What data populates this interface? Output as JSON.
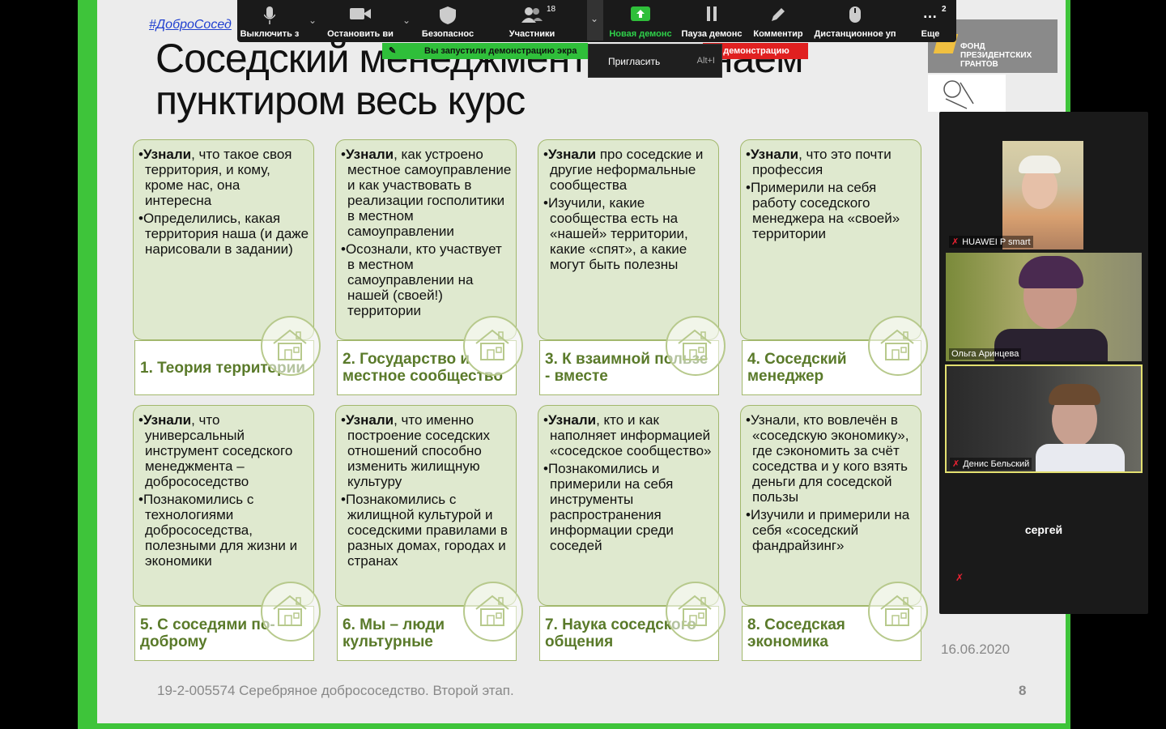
{
  "slide": {
    "hashtag": "#ДоброСосед",
    "title_line1": "Соседский менеджмент –",
    "title_line1_end": "чинаем",
    "title_line2": "пунктиром весь курс",
    "date": "16.06.2020",
    "footer": "19-2-005574 Серебряное добрососедство. Второй этап.",
    "page_number": "8",
    "logo_text": "ФОНД ПРЕЗИДЕНТСКИХ ГРАНТОВ",
    "cards": [
      {
        "bullets": [
          {
            "bold": "Узнали",
            "rest": ", что такое своя территория, и кому, кроме нас, она интересна"
          },
          {
            "bold": "",
            "rest": "Определились, какая территория наша (и даже нарисовали в задании)"
          }
        ],
        "label": "1. Теория территории"
      },
      {
        "bullets": [
          {
            "bold": "Узнали",
            "rest": ", как устроено местное самоуправление и как участвовать в реализации госполитики в местном самоуправлении"
          },
          {
            "bold": "",
            "rest": "Осознали, кто участвует в местном самоуправлении на нашей (своей!) территории"
          }
        ],
        "label": "2. Государство и местное сообщество"
      },
      {
        "bullets": [
          {
            "bold": "Узнали",
            "rest": " про соседские и другие неформальные сообщества"
          },
          {
            "bold": "",
            "rest": "Изучили, какие сообщества есть на «нашей» территории, какие «спят», а какие могут быть полезны"
          }
        ],
        "label": "3. К взаимной пользе - вместе"
      },
      {
        "bullets": [
          {
            "bold": "Узнали",
            "rest": ", что это почти профессия"
          },
          {
            "bold": "",
            "rest": "Примерили на себя работу соседского менеджера на «своей» территории"
          }
        ],
        "label": "4. Соседский менеджер"
      },
      {
        "bullets": [
          {
            "bold": "Узнали",
            "rest": ", что универсальный инструмент соседского менеджмента – добрососедство"
          },
          {
            "bold": "",
            "rest": "Познакомились с технологиями добрососедства, полезными для жизни и экономики"
          }
        ],
        "label": "5. С соседями по-доброму"
      },
      {
        "bullets": [
          {
            "bold": "Узнали",
            "rest": ", что именно построение соседских отношений способно изменить жилищную культуру"
          },
          {
            "bold": "",
            "rest": "Познакомились с жилищной культурой и соседскими правилами в разных домах, городах и странах"
          }
        ],
        "label": "6. Мы – люди культурные"
      },
      {
        "bullets": [
          {
            "bold": "Узнали",
            "rest": ", кто и как наполняет информацией «соседское сообщество»"
          },
          {
            "bold": "",
            "rest": "Познакомились и примерили на себя инструменты распространения информации среди соседей"
          }
        ],
        "label": "7. Наука соседского общения"
      },
      {
        "bullets": [
          {
            "bold": "",
            "rest": "Узнали, кто вовлечён в «соседскую экономику», где сэкономить за счёт соседства и у кого взять деньги для соседской пользы"
          },
          {
            "bold": "",
            "rest": "Изучили и примерили на себя «соседский фандрайзинг»"
          }
        ],
        "label": "8. Соседская экономика"
      }
    ]
  },
  "toolbar": {
    "mute": "Выключить з",
    "video": "Остановить ви",
    "security": "Безопаснос",
    "participants": "Участники",
    "participants_count": "18",
    "new_share": "Новая демонс",
    "pause_share": "Пауза демонс",
    "annotate": "Комментир",
    "remote": "Дистанционное уп",
    "more": "Еще",
    "more_badge": "2",
    "share_notice": "Вы запустили демонстрацию экра",
    "stop_share": "ть демонстрацию",
    "invite": "Пригласить",
    "invite_shortcut": "Alt+I"
  },
  "gallery": {
    "p1": "HUAWEI P smart",
    "p2": "Ольга Аринцева",
    "p3": "Денис Бельский",
    "p4": "сергей"
  }
}
